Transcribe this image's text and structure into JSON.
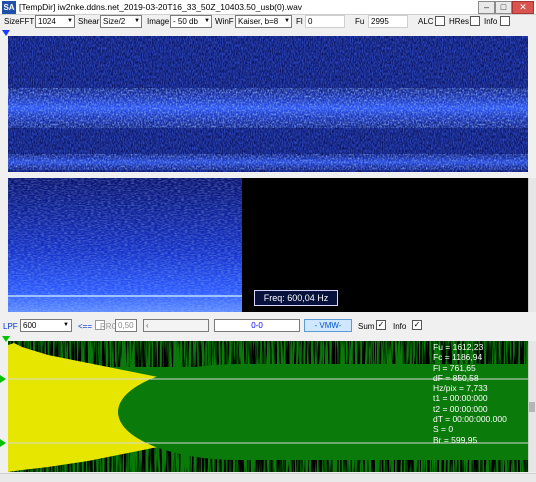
{
  "window": {
    "app_icon_text": "SA",
    "title": "[TempDir] iw2nke.ddns.net_2019-03-20T16_33_50Z_10403.50_usb(0).wav"
  },
  "toolbar": {
    "sizefft_label": "SizeFFT",
    "sizefft_value": "1024",
    "shear_label": "Shear",
    "shear_value": "Size/2",
    "image_label": "Image",
    "image_value": "- 50 db",
    "winf_label": "WinF",
    "winf_value": "Kaiser, b=8",
    "fl_label": "Fl",
    "fl_value": "0",
    "fu_label": "Fu",
    "fu_value": "2995",
    "alc_label": "ALC",
    "alc_checked": false,
    "hres_label": "HRes",
    "hres_checked": false,
    "info_label": "Info",
    "info_checked": false
  },
  "waterfall": {
    "freq_readout": "Freq: 600,04 Hz"
  },
  "filterbar": {
    "lpf_label": "LPF",
    "lpf_value": "600",
    "arrow_label": "<==",
    "rrc_label": "RRC",
    "rrc_value": "0,50",
    "position_display": "0-0",
    "vmw_label": "- VMW-",
    "sum_label": "Sum",
    "sum_checked": true,
    "info_label": "Info",
    "info_checked": true
  },
  "info_panel": {
    "lines": [
      "Fu = 1612,23",
      "Fc = 1186,94",
      "Fl = 761,65",
      "dF = 850,58",
      "Hz/pix = 7,733",
      "t1 = 00:00:000",
      "t2 = 00:00:000",
      "dT = 00:00:000.000",
      "S = 0",
      "Br = 599,95"
    ]
  },
  "colors": {
    "spectrogram_background": "#0a1560",
    "signal_blue": "#2b5cff",
    "envelope_yellow": "#e6e600",
    "envelope_green": "#0a7a0a",
    "vmw_accent": "#0055cc"
  }
}
